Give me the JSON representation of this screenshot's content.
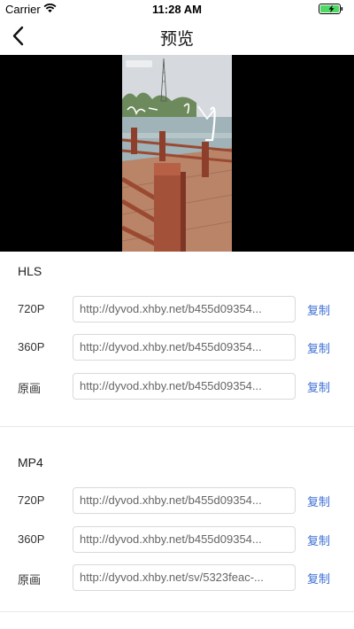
{
  "status_bar": {
    "carrier": "Carrier",
    "time": "11:28 AM"
  },
  "nav": {
    "title": "预览"
  },
  "colors": {
    "link": "#3d6fd6",
    "battery": "#4cd964"
  },
  "icons": [
    "wifi-icon",
    "battery-icon",
    "back-icon"
  ],
  "sections": [
    {
      "title": "HLS",
      "rows": [
        {
          "label": "720P",
          "url": "http://dyvod.xhby.net/b455d09354...",
          "copy_label": "复制"
        },
        {
          "label": "360P",
          "url": "http://dyvod.xhby.net/b455d09354...",
          "copy_label": "复制"
        },
        {
          "label": "原画",
          "url": "http://dyvod.xhby.net/b455d09354...",
          "copy_label": "复制"
        }
      ]
    },
    {
      "title": "MP4",
      "rows": [
        {
          "label": "720P",
          "url": "http://dyvod.xhby.net/b455d09354...",
          "copy_label": "复制"
        },
        {
          "label": "360P",
          "url": "http://dyvod.xhby.net/b455d09354...",
          "copy_label": "复制"
        },
        {
          "label": "原画",
          "url": "http://dyvod.xhby.net/sv/5323feac-...",
          "copy_label": "复制"
        }
      ]
    }
  ]
}
